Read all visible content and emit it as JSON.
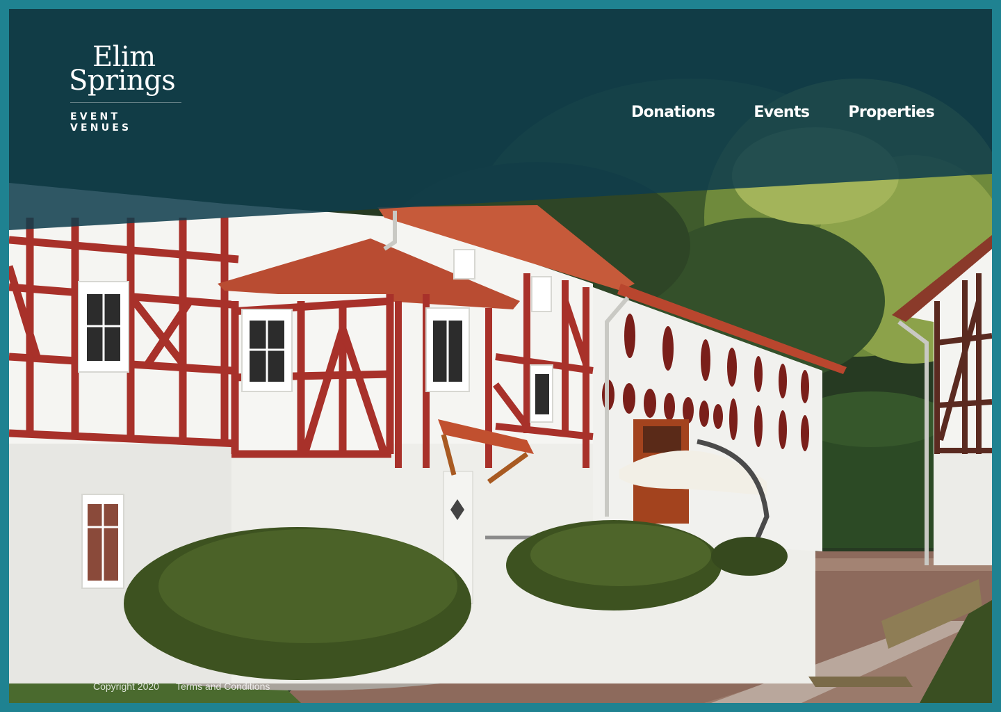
{
  "brand": {
    "name_line1": "Elim",
    "name_line2": "Springs",
    "tagline": "EVENT VENUES"
  },
  "nav": {
    "items": [
      {
        "label": "Donations"
      },
      {
        "label": "Events"
      },
      {
        "label": "Properties"
      }
    ]
  },
  "footer": {
    "copyright": "Copyright 2020",
    "terms": "Terms and Conditions"
  },
  "colors": {
    "border": "#1f8291",
    "header_overlay": "#0e3d4d",
    "timber": "#a8312a",
    "roof": "#b94c32",
    "wall": "#f4f4f1"
  }
}
